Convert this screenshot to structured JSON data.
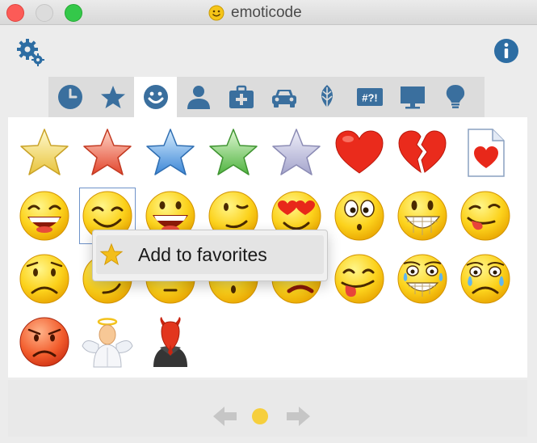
{
  "window": {
    "title": "emoticode"
  },
  "toolbar": {
    "settings_icon": "gear-icon",
    "info_icon": "info-icon"
  },
  "categories": [
    {
      "name": "recent",
      "icon": "clock-icon",
      "active": false
    },
    {
      "name": "favorites",
      "icon": "star-icon",
      "active": false
    },
    {
      "name": "smileys",
      "icon": "smiley-icon",
      "active": true
    },
    {
      "name": "people",
      "icon": "person-icon",
      "active": false
    },
    {
      "name": "medical",
      "icon": "first-aid-icon",
      "active": false
    },
    {
      "name": "travel",
      "icon": "car-icon",
      "active": false
    },
    {
      "name": "nature",
      "icon": "leaf-icon",
      "active": false
    },
    {
      "name": "symbols",
      "icon": "symbols-icon",
      "label": "#?!",
      "active": false
    },
    {
      "name": "objects",
      "icon": "monitor-icon",
      "active": false
    },
    {
      "name": "ideas",
      "icon": "lightbulb-icon",
      "active": false
    }
  ],
  "grid": [
    "yellow-star",
    "red-star",
    "blue-star",
    "green-star",
    "lavender-star",
    "heart",
    "broken-heart",
    "heart-document",
    "grinning",
    "smiling-eyes-closed",
    "big-grin",
    "winking",
    "heart-eyes",
    "surprised",
    "toothy-grin",
    "tongue-wink",
    "worried",
    "content",
    "neutral",
    "hushed",
    "frowning",
    "tongue-out",
    "laughing-tears",
    "crying",
    "angry",
    "angel",
    "devil"
  ],
  "selected_index": 9,
  "context_menu": {
    "item_label": "Add to favorites",
    "item_icon": "star-icon"
  },
  "pagination": {
    "current_page": 1,
    "total_pages": 1
  },
  "colors": {
    "accent": "#3a6f9e",
    "smiley_yellow": "#f9c81a",
    "panel": "#ffffff"
  }
}
